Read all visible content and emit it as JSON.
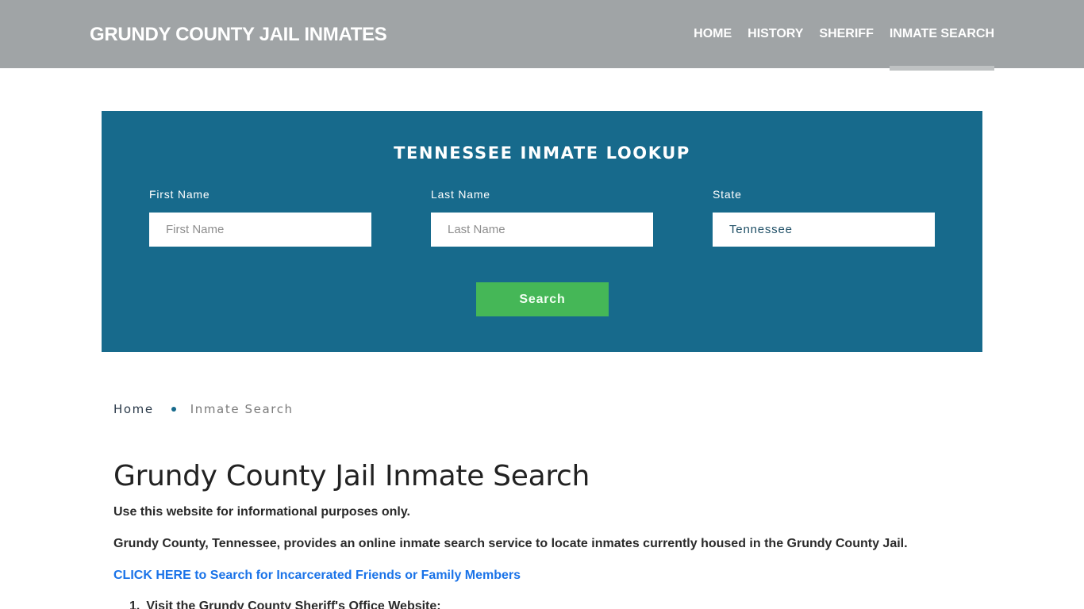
{
  "header": {
    "brand": "GRUNDY COUNTY JAIL INMATES",
    "nav": [
      {
        "label": "HOME",
        "active": false
      },
      {
        "label": "HISTORY",
        "active": false
      },
      {
        "label": "SHERIFF",
        "active": false
      },
      {
        "label": "INMATE SEARCH",
        "active": true
      }
    ]
  },
  "lookup": {
    "title": "TENNESSEE INMATE LOOKUP",
    "first_name": {
      "label": "First Name",
      "placeholder": "First Name",
      "value": ""
    },
    "last_name": {
      "label": "Last Name",
      "placeholder": "Last Name",
      "value": ""
    },
    "state": {
      "label": "State",
      "value": "Tennessee"
    },
    "search_button": "Search"
  },
  "breadcrumb": {
    "home": "Home",
    "current": "Inmate Search"
  },
  "content": {
    "title": "Grundy County Jail Inmate Search",
    "disclaimer": "Use this website for informational purposes only.",
    "intro": "Grundy County, Tennessee, provides an online inmate search service to locate inmates currently housed in the Grundy County Jail.",
    "cta_link": "CLICK HERE to Search for Incarcerated Friends or Family Members",
    "steps": [
      {
        "num": "1.",
        "text": "Visit the Grundy County Sheriff's Office Website:"
      }
    ]
  },
  "colors": {
    "topbar": "#a0a4a6",
    "lookup_bg": "#176a8c",
    "search_button": "#45b757",
    "link": "#1a73e8"
  }
}
